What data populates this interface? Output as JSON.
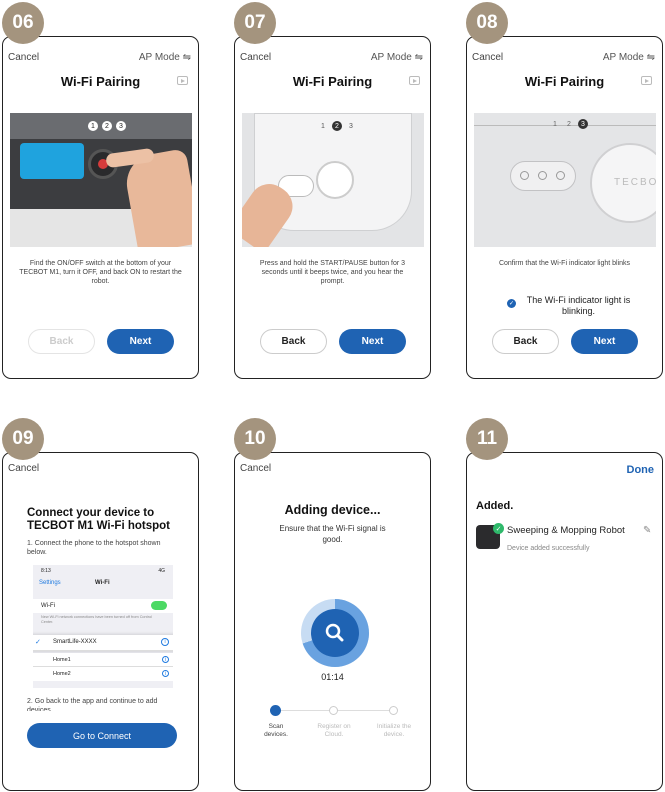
{
  "steps": {
    "s06": "06",
    "s07": "07",
    "s08": "08",
    "s09": "09",
    "s10": "10",
    "s11": "11"
  },
  "common": {
    "cancel": "Cancel",
    "ap_mode": "AP Mode",
    "wifi_pairing": "Wi-Fi Pairing",
    "back": "Back",
    "next": "Next"
  },
  "p06": {
    "desc": "Find the ON/OFF switch at the bottom of your TECBOT M1, turn it OFF, and back ON to restart the robot.",
    "dots": [
      "1",
      "2",
      "3"
    ]
  },
  "p07": {
    "desc": "Press and hold the START/PAUSE button for 3 seconds until it beeps twice, and you hear the prompt.",
    "dots": [
      "1",
      "2",
      "3"
    ]
  },
  "p08": {
    "desc": "Confirm that the Wi-Fi indicator light blinks",
    "check_label": "The Wi-Fi indicator light is blinking.",
    "check_state": true,
    "dots": [
      "1",
      "2",
      "3"
    ],
    "robot_text": "TECBO"
  },
  "p09": {
    "title": "Connect your device to TECBOT M1 Wi-Fi hotspot",
    "step1": "1. Connect the phone to the hotspot shown below.",
    "step2": "2. Go back to the app and continue to add devices",
    "connect_btn": "Go to Connect",
    "ios": {
      "time": "8:13",
      "status": "4G",
      "back": "Settings",
      "header": "Wi-Fi",
      "wifi_label": "Wi-Fi",
      "note": "New Wi-Fi network connections have been turned off from Control Center.",
      "networks": [
        "SmartLife-XXXX",
        "Home1",
        "Home2"
      ]
    }
  },
  "p10": {
    "title": "Adding device...",
    "subtitle": "Ensure that the Wi-Fi signal is good.",
    "timer": "01:14",
    "progress_fraction": 0.3,
    "stages": [
      "Scan devices.",
      "Register on Cloud.",
      "Initialize the device."
    ]
  },
  "p11": {
    "done": "Done",
    "added": "Added.",
    "device_name": "Sweeping & Mopping Robot",
    "status": "Device added successfully"
  },
  "colors": {
    "accent": "#1f63b3",
    "badge": "#a4947e",
    "success": "#2fb96b"
  }
}
